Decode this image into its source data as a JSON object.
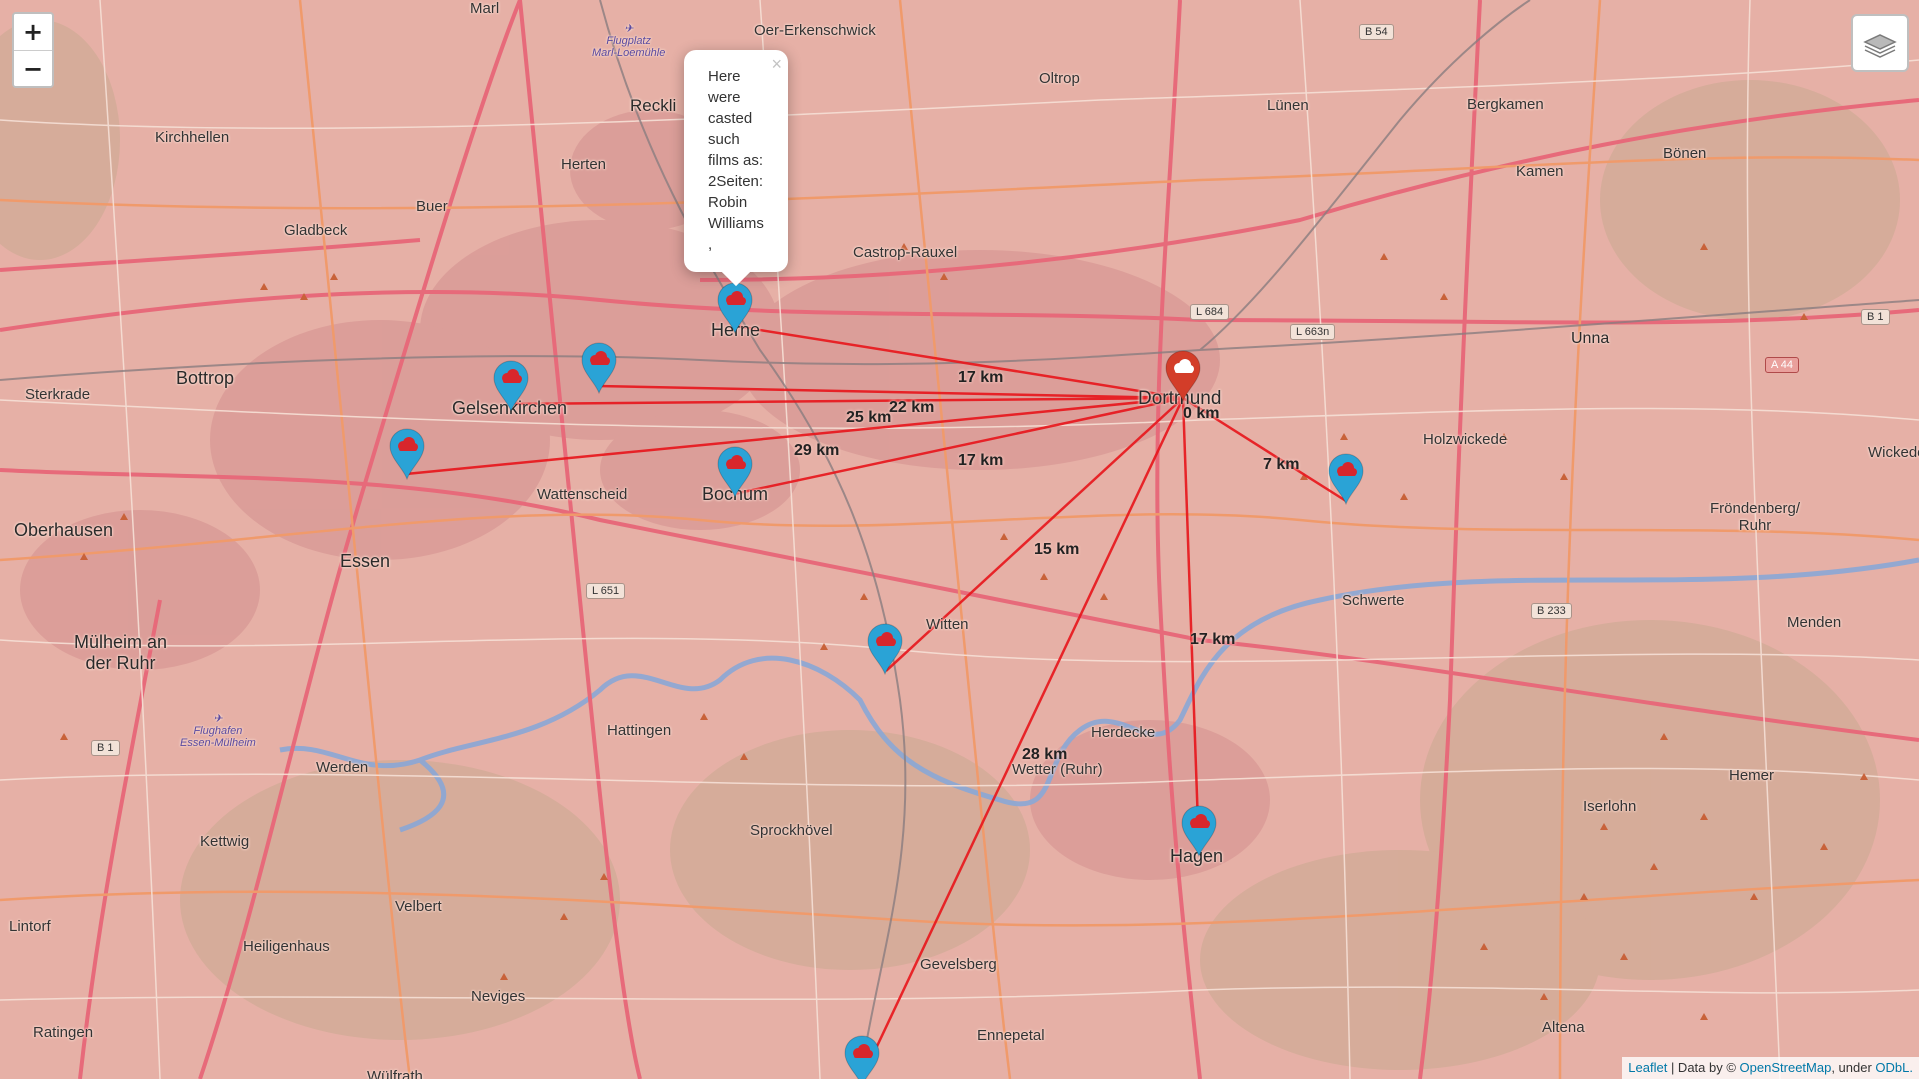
{
  "map": {
    "places_city": [
      {
        "name": "Dortmund",
        "id": "dortmund"
      },
      {
        "name": "Essen",
        "id": "essen"
      },
      {
        "name": "Bochum",
        "id": "bochum"
      },
      {
        "name": "Herne",
        "id": "herne"
      },
      {
        "name": "Gelsenkirchen",
        "id": "gelsenkirchen"
      },
      {
        "name": "Bottrop",
        "id": "bottrop"
      },
      {
        "name": "Oberhausen",
        "id": "oberhausen"
      },
      {
        "name": "Hagen",
        "id": "hagen"
      },
      {
        "name": "Mülheim an der Ruhr",
        "id": "muelheim"
      },
      {
        "name": "Unna",
        "id": "unna"
      },
      {
        "name": "Recklinghausen",
        "id": "recklinghausen"
      }
    ],
    "places_town": [
      "Marl",
      "Oer-Erkenschwick",
      "Oltrop",
      "Lünen",
      "Bergkamen",
      "Kamen",
      "Bönen",
      "Herten",
      "Kirchhellen",
      "Gladbeck",
      "Buer",
      "Castrop-Rauxel",
      "Sterkrade",
      "Wattenscheid",
      "Holzwickede",
      "Fröndenberg/Ruhr",
      "Schwerte",
      "Witten",
      "Hattingen",
      "Herdecke",
      "Wetter (Ruhr)",
      "Sprockhövel",
      "Kettwig",
      "Werden",
      "Velbert",
      "Heiligenhaus",
      "Lintorf",
      "Ratingen",
      "Neviges",
      "Gevelsberg",
      "Ennepetal",
      "Iserlohn",
      "Hemer",
      "Menden",
      "Altena",
      "Wülfrath",
      "Wickede"
    ],
    "airports": [
      "Flugplatz Marl-Loemühle",
      "Flughafen Essen-Mülheim"
    ],
    "road_shields": [
      "B 54",
      "L 684",
      "L 663n",
      "B 1",
      "A 44",
      "L 651",
      "B 233",
      "B 1"
    ],
    "distance_labels": [
      "17 km",
      "22 km",
      "25 km",
      "29 km",
      "17 km",
      "0 km",
      "7 km",
      "15 km",
      "17 km",
      "28 km"
    ]
  },
  "popup": {
    "lines": [
      "Here",
      "were",
      "casted",
      "such",
      "films as:",
      "2Seiten:",
      "Robin",
      "Williams",
      ","
    ],
    "close": "×"
  },
  "controls": {
    "zoom_in": "+",
    "zoom_out": "−"
  },
  "attribution": {
    "leaflet": "Leaflet",
    "text1": " | Data by © ",
    "osm": "OpenStreetMap",
    "text2": ", under ",
    "odbl": "ODbL."
  },
  "colors": {
    "route": "#e8151b",
    "marker_blue": "#2aa3d6",
    "marker_red": "#d33d29",
    "cloud": "#d8262c"
  }
}
